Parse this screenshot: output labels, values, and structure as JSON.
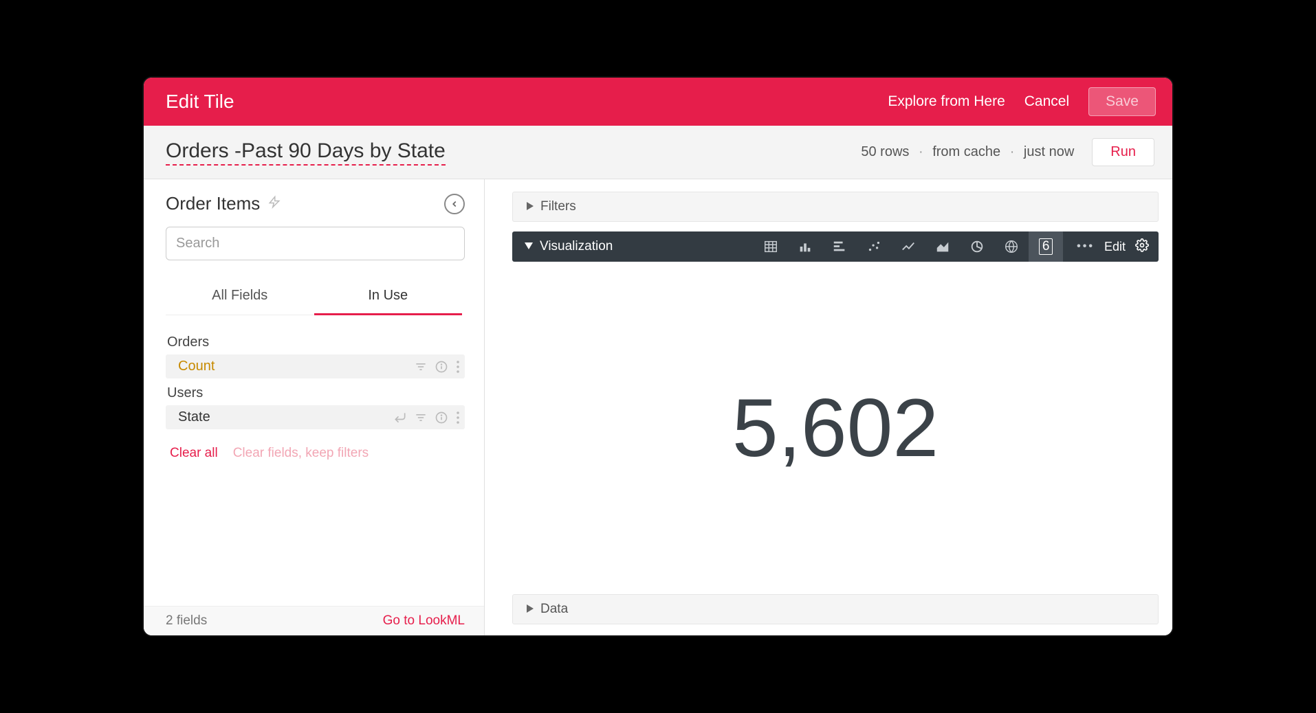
{
  "header": {
    "title": "Edit Tile",
    "explore_link": "Explore from Here",
    "cancel": "Cancel",
    "save": "Save"
  },
  "page": {
    "title": "Orders -Past 90 Days by State",
    "status_rows": "50 rows",
    "status_cache": "from cache",
    "status_time": "just now",
    "run": "Run"
  },
  "sidebar": {
    "explore_name": "Order Items",
    "search_placeholder": "Search",
    "tabs": {
      "all": "All Fields",
      "in_use": "In Use"
    },
    "groups": [
      {
        "label": "Orders",
        "fields": [
          {
            "name": "Count",
            "kind": "measure"
          }
        ]
      },
      {
        "label": "Users",
        "fields": [
          {
            "name": "State",
            "kind": "dimension"
          }
        ]
      }
    ],
    "clear_all": "Clear all",
    "clear_keep": "Clear fields, keep filters",
    "footer_count": "2 fields",
    "footer_link": "Go to LookML"
  },
  "main": {
    "filters_label": "Filters",
    "viz_label": "Visualization",
    "viz_edit": "Edit",
    "big_number": "5,602",
    "selected_viz_glyph": "6",
    "data_label": "Data"
  },
  "colors": {
    "brand": "#e61e4b",
    "dark": "#333b42"
  }
}
